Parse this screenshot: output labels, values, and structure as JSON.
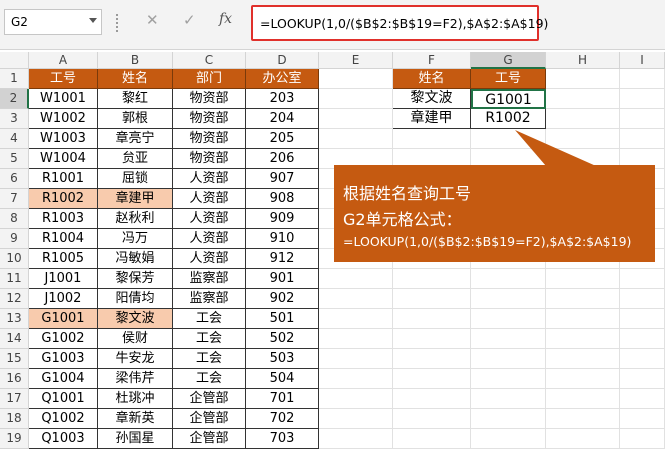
{
  "name_box": "G2",
  "formula_icons": {
    "cancel": "✕",
    "enter": "✓",
    "fx": "fx"
  },
  "formula": "=LOOKUP(1,0/($B$2:$B$19=F2),$A$2:$A$19)",
  "columns": [
    "A",
    "B",
    "C",
    "D",
    "E",
    "F",
    "G",
    "H",
    "I"
  ],
  "rows": [
    "1",
    "2",
    "3",
    "4",
    "5",
    "6",
    "7",
    "8",
    "9",
    "10",
    "11",
    "12",
    "13",
    "14",
    "15",
    "16",
    "17",
    "18",
    "19"
  ],
  "table_headers": [
    "工号",
    "姓名",
    "部门",
    "办公室"
  ],
  "table_rows": [
    [
      "W1001",
      "黎红",
      "物资部",
      "203"
    ],
    [
      "W1002",
      "郭根",
      "物资部",
      "204"
    ],
    [
      "W1003",
      "章亮宁",
      "物资部",
      "205"
    ],
    [
      "W1004",
      "贠亚",
      "物资部",
      "206"
    ],
    [
      "R1001",
      "屈锁",
      "人资部",
      "907"
    ],
    [
      "R1002",
      "章建甲",
      "人资部",
      "908"
    ],
    [
      "R1003",
      "赵秋利",
      "人资部",
      "909"
    ],
    [
      "R1004",
      "冯万",
      "人资部",
      "910"
    ],
    [
      "R1005",
      "冯敏娟",
      "人资部",
      "912"
    ],
    [
      "J1001",
      "黎保芳",
      "监察部",
      "901"
    ],
    [
      "J1002",
      "阳倩均",
      "监察部",
      "902"
    ],
    [
      "G1001",
      "黎文波",
      "工会",
      "501"
    ],
    [
      "G1002",
      "侯财",
      "工会",
      "502"
    ],
    [
      "G1003",
      "牛安龙",
      "工会",
      "503"
    ],
    [
      "G1004",
      "梁伟芹",
      "工会",
      "504"
    ],
    [
      "Q1001",
      "杜珧冲",
      "企管部",
      "701"
    ],
    [
      "Q1002",
      "章新英",
      "企管部",
      "702"
    ],
    [
      "Q1003",
      "孙国星",
      "企管部",
      "703"
    ]
  ],
  "lookup_headers": [
    "姓名",
    "工号"
  ],
  "lookup_rows": [
    [
      "黎文波",
      "G1001"
    ],
    [
      "章建甲",
      "R1002"
    ]
  ],
  "callout": {
    "line1": "根据姓名查询工号",
    "line2": "G2单元格公式：",
    "line3": "=LOOKUP(1,0/($B$2:$B$19=F2),$A$2:$A$19)"
  },
  "colors": {
    "header_fill": "#c55a11",
    "highlight_fill": "#f8cbad",
    "selection": "#217346",
    "formula_outline": "#e0302b"
  }
}
